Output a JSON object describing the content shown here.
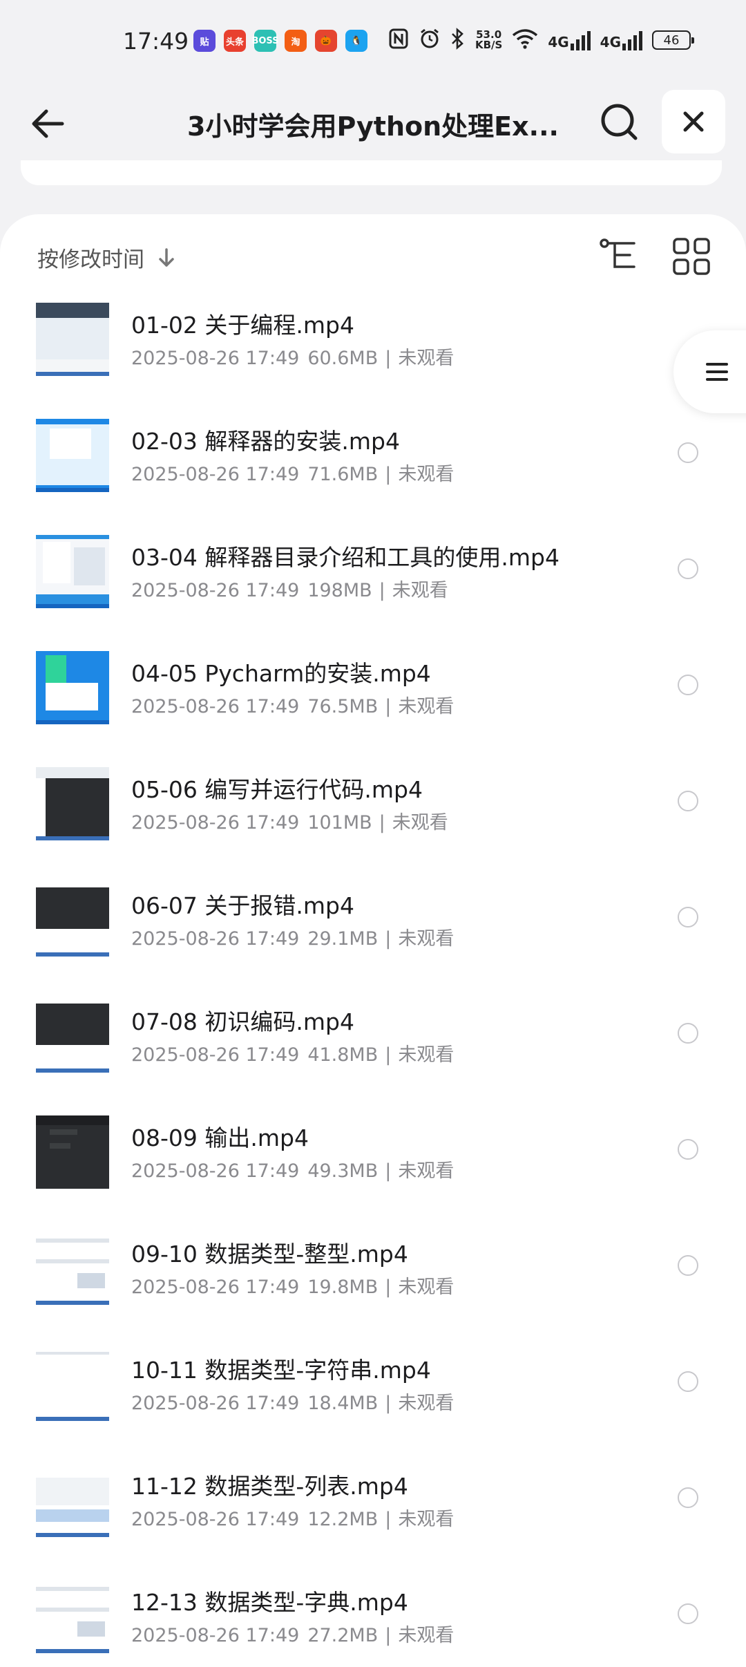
{
  "status_bar": {
    "time": "17:49",
    "apps": [
      {
        "icon": "tieba-app-icon",
        "glyph": "贴",
        "color": "#5b4bdb"
      },
      {
        "icon": "toutiao-app-icon",
        "glyph": "头条",
        "color": "#e8402f"
      },
      {
        "icon": "boss-app-icon",
        "glyph": "BOSS",
        "color": "#2dc0b4"
      },
      {
        "icon": "taobao-app-icon",
        "glyph": "淘",
        "color": "#f35e14"
      },
      {
        "icon": "pinduoduo-app-icon",
        "glyph": "🎃",
        "color": "#e5452f"
      },
      {
        "icon": "qq-app-icon",
        "glyph": "🐧",
        "color": "#1ca3f0"
      }
    ],
    "net_speed_value": "53.0",
    "net_speed_unit": "KB/S",
    "signal1_label": "4G",
    "signal2_label": "4G",
    "battery": "46"
  },
  "header": {
    "title": "3小时学会用Python处理Ex..."
  },
  "sort": {
    "label": "按修改时间"
  },
  "files": [
    {
      "name": "01-02 关于编程.mp4",
      "date": "2025-08-26 17:49",
      "size": "60.6MB",
      "status": "未观看",
      "thumb": "light-ide"
    },
    {
      "name": "02-03 解释器的安装.mp4",
      "date": "2025-08-26 17:49",
      "size": "71.6MB",
      "status": "未观看",
      "thumb": "blue-installer"
    },
    {
      "name": "03-04 解释器目录介绍和工具的使用.mp4",
      "date": "2025-08-26 17:49",
      "size": "198MB",
      "status": "未观看",
      "thumb": "blue-window"
    },
    {
      "name": "04-05 Pycharm的安装.mp4",
      "date": "2025-08-26 17:49",
      "size": "76.5MB",
      "status": "未观看",
      "thumb": "green-installer"
    },
    {
      "name": "05-06 编写并运行代码.mp4",
      "date": "2025-08-26 17:49",
      "size": "101MB",
      "status": "未观看",
      "thumb": "dark-split"
    },
    {
      "name": "06-07 关于报错.mp4",
      "date": "2025-08-26 17:49",
      "size": "29.1MB",
      "status": "未观看",
      "thumb": "dark-code"
    },
    {
      "name": "07-08 初识编码.mp4",
      "date": "2025-08-26 17:49",
      "size": "41.8MB",
      "status": "未观看",
      "thumb": "dark-code"
    },
    {
      "name": "08-09 输出.mp4",
      "date": "2025-08-26 17:49",
      "size": "49.3MB",
      "status": "未观看",
      "thumb": "dark-full"
    },
    {
      "name": "09-10 数据类型-整型.mp4",
      "date": "2025-08-26 17:49",
      "size": "19.8MB",
      "status": "未观看",
      "thumb": "white-doc"
    },
    {
      "name": "10-11 数据类型-字符串.mp4",
      "date": "2025-08-26 17:49",
      "size": "18.4MB",
      "status": "未观看",
      "thumb": "white-blank"
    },
    {
      "name": "11-12 数据类型-列表.mp4",
      "date": "2025-08-26 17:49",
      "size": "12.2MB",
      "status": "未观看",
      "thumb": "white-list"
    },
    {
      "name": "12-13 数据类型-字典.mp4",
      "date": "2025-08-26 17:49",
      "size": "27.2MB",
      "status": "未观看",
      "thumb": "white-doc"
    }
  ]
}
